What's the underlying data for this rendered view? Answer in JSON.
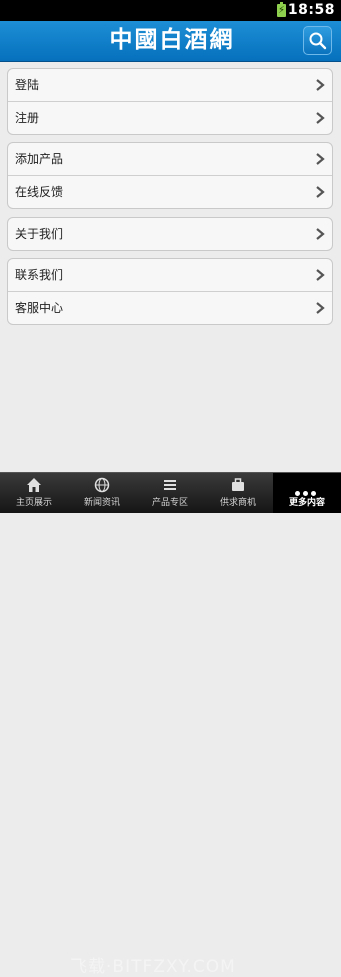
{
  "status_bar": {
    "time": "18:58",
    "battery_glyph": "⚡"
  },
  "header": {
    "logo_text": "中國白酒網",
    "search_icon": "search-icon"
  },
  "menu": {
    "group1": [
      {
        "label": "登陆"
      },
      {
        "label": "注册"
      }
    ],
    "group2": [
      {
        "label": "添加产品"
      },
      {
        "label": "在线反馈"
      }
    ],
    "group3": [
      {
        "label": "关于我们"
      }
    ],
    "group4": [
      {
        "label": "联系我们"
      },
      {
        "label": "客服中心"
      }
    ]
  },
  "tabbar": {
    "tabs": [
      {
        "label": "主页展示",
        "icon": "home-icon"
      },
      {
        "label": "新闻资讯",
        "icon": "news-icon"
      },
      {
        "label": "产品专区",
        "icon": "products-icon"
      },
      {
        "label": "供求商机",
        "icon": "trade-icon"
      },
      {
        "label": "更多内容",
        "icon": "more-icon",
        "active": true
      }
    ]
  },
  "watermark": "飞载·BITFZXY.COM",
  "colors": {
    "header": "#0a7dc8",
    "tab_active": "#000000"
  }
}
